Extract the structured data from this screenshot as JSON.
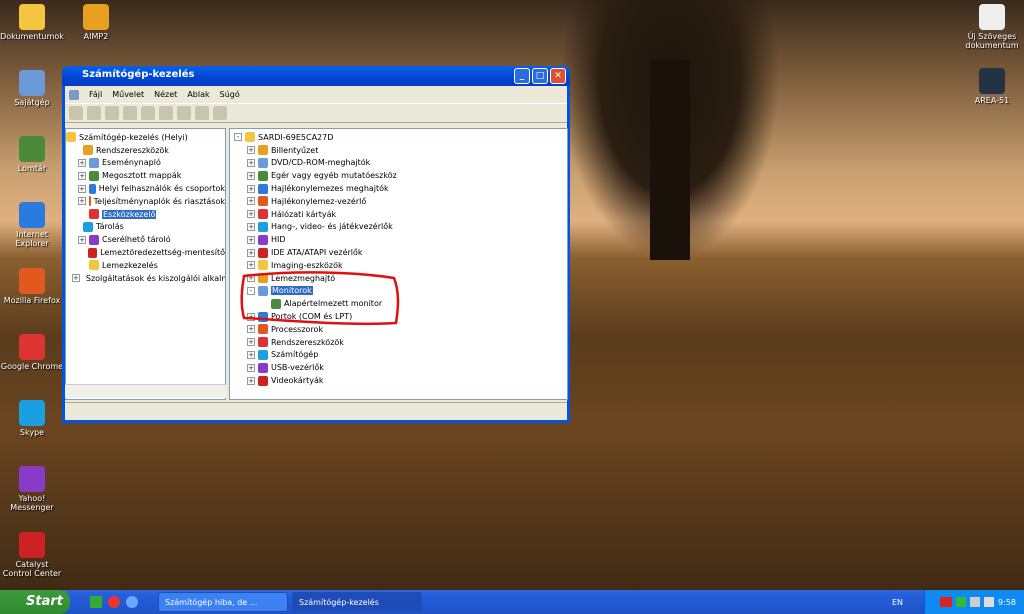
{
  "desktop": {
    "left_icons": [
      "Dokumentumok",
      "AIMP2",
      "Sajátgép",
      "Lomtár",
      "Internet Explorer",
      "Mozilla Firefox",
      "Google Chrome",
      "Skype",
      "Yahoo! Messenger",
      "Catalyst Control Center"
    ],
    "right_icons": [
      "Új Szöveges dokumentum",
      "AREA-51"
    ]
  },
  "window": {
    "title": "Számítógép-kezelés",
    "menu": [
      "Fájl",
      "Művelet",
      "Nézet",
      "Ablak",
      "Súgó"
    ],
    "left_tree": [
      {
        "label": "Számítógép-kezelés (Helyi)",
        "level": 0
      },
      {
        "label": "Rendszereszközök",
        "level": 1
      },
      {
        "label": "Eseménynapló",
        "level": 2,
        "expander": "+"
      },
      {
        "label": "Megosztott mappák",
        "level": 2,
        "expander": "+"
      },
      {
        "label": "Helyi felhasználók és csoportok",
        "level": 2,
        "expander": "+"
      },
      {
        "label": "Teljesítménynaplók és riasztások",
        "level": 2,
        "expander": "+"
      },
      {
        "label": "Eszközkezelő",
        "level": 2,
        "selected": true
      },
      {
        "label": "Tárolás",
        "level": 1
      },
      {
        "label": "Cserélhető tároló",
        "level": 2,
        "expander": "+"
      },
      {
        "label": "Lemeztöredezettség-mentesítő",
        "level": 2
      },
      {
        "label": "Lemezkezelés",
        "level": 2
      },
      {
        "label": "Szolgáltatások és kiszolgálói alkalmazások",
        "level": 1,
        "expander": "+"
      }
    ],
    "device_tree": [
      {
        "label": "SARDI-69E5CA27D",
        "level": 0,
        "expander": "-"
      },
      {
        "label": "Billentyűzet",
        "level": 1,
        "expander": "+"
      },
      {
        "label": "DVD/CD-ROM-meghajtók",
        "level": 1,
        "expander": "+"
      },
      {
        "label": "Egér vagy egyéb mutatóeszköz",
        "level": 1,
        "expander": "+"
      },
      {
        "label": "Hajlékonylemezes meghajtók",
        "level": 1,
        "expander": "+"
      },
      {
        "label": "Hajlékonylemez-vezérlő",
        "level": 1,
        "expander": "+"
      },
      {
        "label": "Hálózati kártyák",
        "level": 1,
        "expander": "+"
      },
      {
        "label": "Hang-, video- és játékvezérlők",
        "level": 1,
        "expander": "+"
      },
      {
        "label": "HID",
        "level": 1,
        "expander": "+"
      },
      {
        "label": "IDE ATA/ATAPI vezérlők",
        "level": 1,
        "expander": "+"
      },
      {
        "label": "Imaging-eszközök",
        "level": 1,
        "expander": "+"
      },
      {
        "label": "Lemezmeghajtó",
        "level": 1,
        "expander": "+"
      },
      {
        "label": "Monitorok",
        "level": 1,
        "expander": "-",
        "selected": true
      },
      {
        "label": "Alapértelmezett monitor",
        "level": 2
      },
      {
        "label": "Portok (COM és LPT)",
        "level": 1,
        "expander": "+"
      },
      {
        "label": "Processzorok",
        "level": 1,
        "expander": "+"
      },
      {
        "label": "Rendszereszközök",
        "level": 1,
        "expander": "+"
      },
      {
        "label": "Számítógép",
        "level": 1,
        "expander": "+"
      },
      {
        "label": "USB-vezérlők",
        "level": 1,
        "expander": "+"
      },
      {
        "label": "Videokártyák",
        "level": 1,
        "expander": "+"
      }
    ]
  },
  "taskbar": {
    "start": "Start",
    "tasks": [
      "Számítógép hiba, de ...",
      "Számítógép-kezelés"
    ],
    "language": "EN",
    "clock": "9:58"
  },
  "colors": {
    "selection": "#316ac5",
    "titlebar": "#0054e3",
    "annotation": "#e01010"
  }
}
